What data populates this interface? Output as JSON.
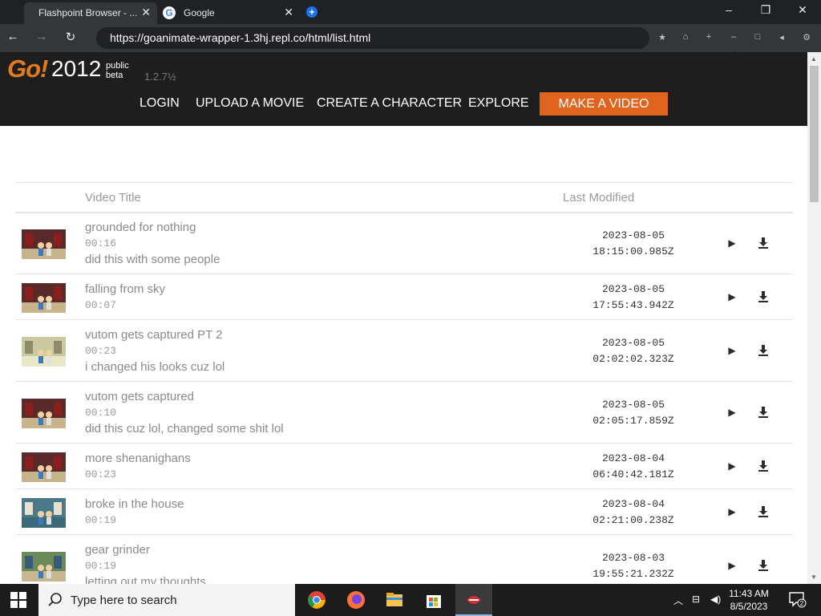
{
  "browser": {
    "tabs": [
      {
        "title": "Flashpoint Browser - ...",
        "active": true
      },
      {
        "title": "Google",
        "active": false
      }
    ],
    "url": "https://goanimate-wrapper-1.3hj.repl.co/html/list.html",
    "window_controls": {
      "minimize": "–",
      "restore": "❐",
      "close": "✕"
    }
  },
  "site": {
    "logo_go": "Go!",
    "logo_year": "2012",
    "logo_badge_line1": "public",
    "logo_badge_line2": "beta",
    "version": "1.2.7½",
    "nav": [
      "LOGIN",
      "UPLOAD A MOVIE",
      "CREATE A CHARACTER",
      "EXPLORE"
    ],
    "cta": "MAKE A VIDEO",
    "accent_color": "#e0641e"
  },
  "table": {
    "headers": {
      "title": "Video Title",
      "modified": "Last Modified"
    },
    "rows": [
      {
        "title": "grounded for nothing",
        "duration": "00:16",
        "description": "did this with some people",
        "date": "2023-08-05",
        "time": "18:15:00.985Z"
      },
      {
        "title": "falling from sky",
        "duration": "00:07",
        "description": "",
        "date": "2023-08-05",
        "time": "17:55:43.942Z"
      },
      {
        "title": "vutom gets captured PT 2",
        "duration": "00:23",
        "description": "i changed his looks cuz lol",
        "date": "2023-08-05",
        "time": "02:02:02.323Z"
      },
      {
        "title": "vutom gets captured",
        "duration": "00:10",
        "description": "did this cuz lol, changed some shit lol",
        "date": "2023-08-05",
        "time": "02:05:17.859Z"
      },
      {
        "title": "more shenanighans",
        "duration": "00:23",
        "description": "",
        "date": "2023-08-04",
        "time": "06:40:42.181Z"
      },
      {
        "title": "broke in the house",
        "duration": "00:19",
        "description": "",
        "date": "2023-08-04",
        "time": "02:21:00.238Z"
      },
      {
        "title": "gear grinder",
        "duration": "00:19",
        "description": "letting out my thoughts",
        "date": "2023-08-03",
        "time": "19:55:21.232Z"
      }
    ]
  },
  "taskbar": {
    "search_placeholder": "Type here to search",
    "time": "11:43 AM",
    "date": "8/5/2023",
    "notifications": "2"
  }
}
